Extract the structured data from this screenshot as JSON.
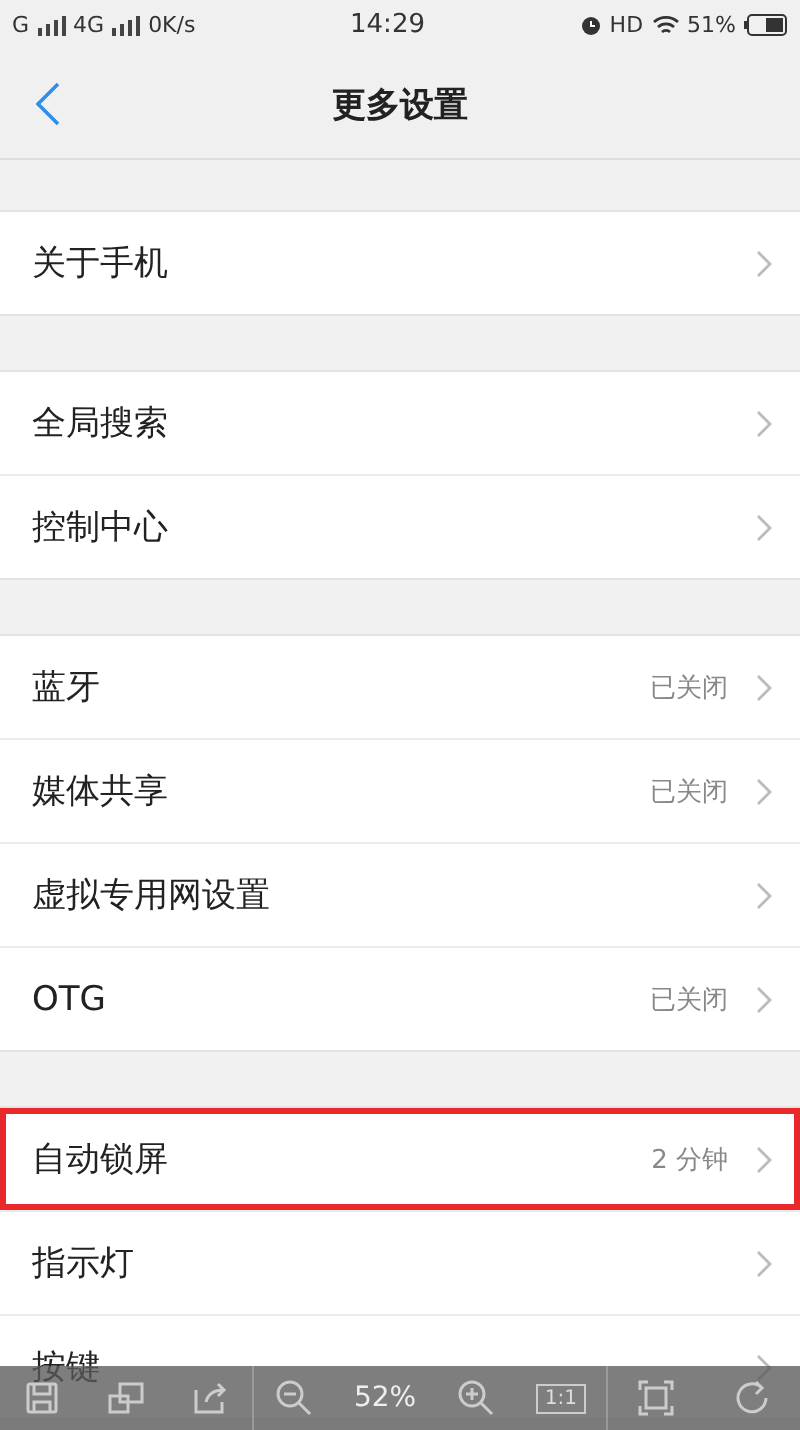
{
  "status_bar": {
    "carrier_1": "G",
    "carrier_2": "4G",
    "speed": "0K/s",
    "time": "14:29",
    "hd": "HD",
    "battery": "51%"
  },
  "nav": {
    "title": "更多设置"
  },
  "groups": [
    {
      "rows": [
        {
          "label": "关于手机",
          "highlighted": false
        }
      ]
    },
    {
      "rows": [
        {
          "label": "全局搜索",
          "highlighted": false
        },
        {
          "label": "控制中心",
          "highlighted": false
        }
      ]
    },
    {
      "rows": [
        {
          "label": "蓝牙",
          "value": "已关闭",
          "highlighted": false
        },
        {
          "label": "媒体共享",
          "value": "已关闭",
          "highlighted": false
        },
        {
          "label": "虚拟专用网设置",
          "highlighted": false
        },
        {
          "label": "OTG",
          "value": "已关闭",
          "highlighted": false
        }
      ]
    },
    {
      "rows": [
        {
          "label": "自动锁屏",
          "value": "2 分钟",
          "highlighted": true
        },
        {
          "label": "指示灯",
          "highlighted": false
        },
        {
          "label": "按键",
          "highlighted": false
        }
      ]
    }
  ],
  "viewer_toolbar": {
    "zoom": "52%",
    "actual_size": "1:1"
  }
}
